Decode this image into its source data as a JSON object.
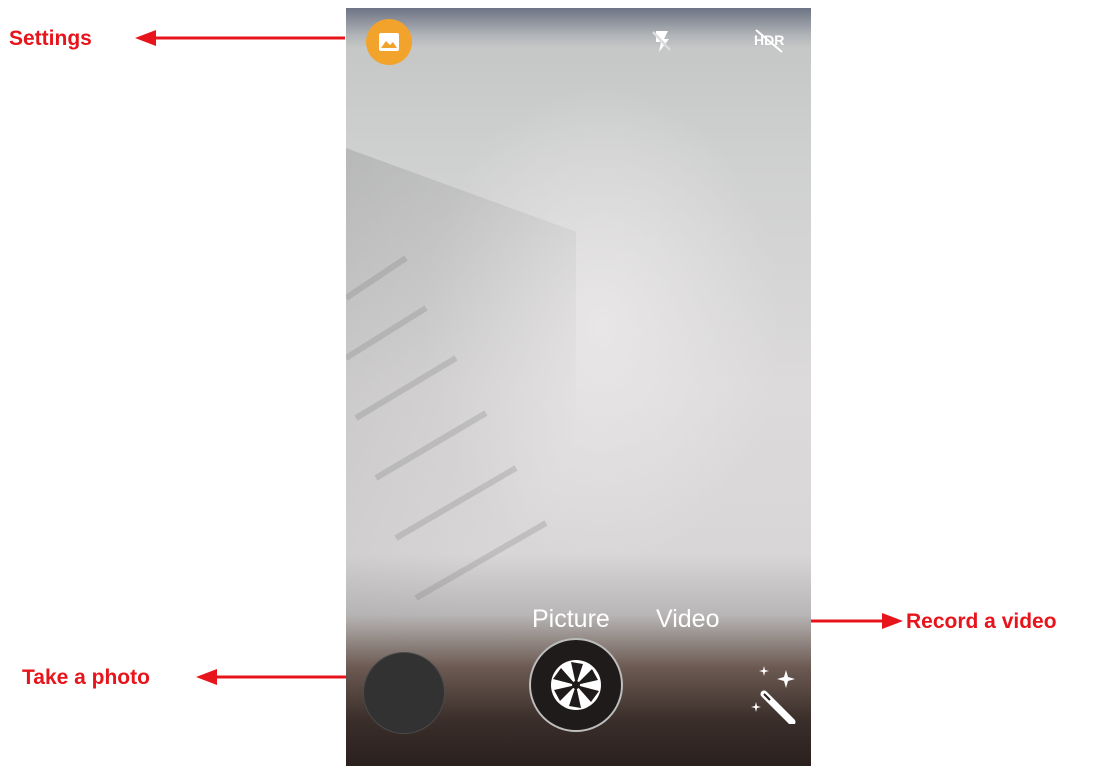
{
  "annotations": {
    "settings": "Settings",
    "record_video": "Record a video",
    "take_photo": "Take a photo"
  },
  "camera": {
    "modes": {
      "picture": "Picture",
      "video": "Video"
    },
    "top_bar": {
      "gallery_icon": "image-icon",
      "flash_icon": "flash-off-icon",
      "hdr_icon": "hdr-off-icon",
      "hdr_text": "HDR"
    },
    "bottom_bar": {
      "thumbnail": "last-photo-thumbnail",
      "shutter_icon": "shutter-aperture-icon",
      "effects_icon": "magic-wand-icon"
    }
  },
  "colors": {
    "annotation": "#e8141b",
    "gallery_button": "#f1a32b"
  }
}
